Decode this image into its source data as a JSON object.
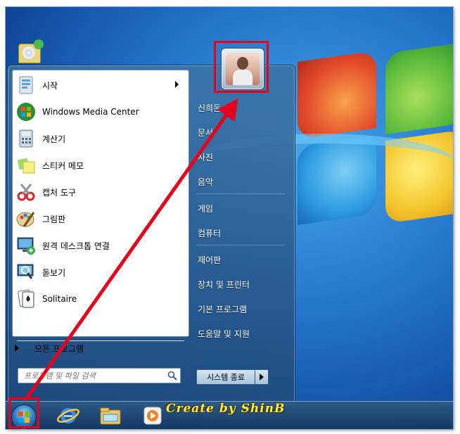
{
  "colors": {
    "highlight": "#e6001c",
    "desktop": "#1f6fc7",
    "watermark": "#ffef3a"
  },
  "start_menu": {
    "programs": [
      {
        "label": "시작",
        "icon": "getting-started-icon",
        "has_submenu": true
      },
      {
        "label": "Windows Media Center",
        "icon": "media-center-icon",
        "has_submenu": false
      },
      {
        "label": "계산기",
        "icon": "calculator-icon",
        "has_submenu": false
      },
      {
        "label": "스티커 메모",
        "icon": "sticky-notes-icon",
        "has_submenu": false
      },
      {
        "label": "캡처 도구",
        "icon": "snipping-tool-icon",
        "has_submenu": false
      },
      {
        "label": "그림판",
        "icon": "paint-icon",
        "has_submenu": false
      },
      {
        "label": "원격 데스크톱 연결",
        "icon": "remote-desktop-icon",
        "has_submenu": false
      },
      {
        "label": "돋보기",
        "icon": "magnifier-icon",
        "has_submenu": false
      },
      {
        "label": "Solitaire",
        "icon": "solitaire-icon",
        "has_submenu": false
      }
    ],
    "all_programs": "모든 프로그램",
    "search_placeholder": "프로그램 및 파일 검색",
    "right_items": [
      "신희돈",
      "문서",
      "사진",
      "음악",
      "게임",
      "컴퓨터",
      "제어판",
      "장치 및 프린터",
      "기본 프로그램",
      "도움말 및 지원"
    ],
    "shutdown_label": "시스템 종료"
  },
  "watermark": "Create by ShinB",
  "taskbar": {
    "icons": [
      "start-orb-icon",
      "internet-explorer-icon",
      "windows-explorer-icon",
      "media-player-icon"
    ]
  }
}
